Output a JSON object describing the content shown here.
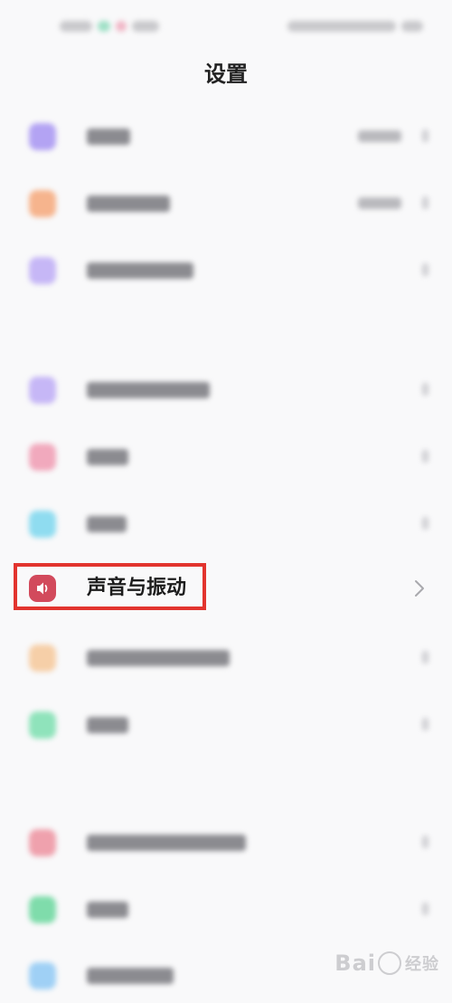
{
  "header": {
    "title": "设置"
  },
  "highlighted_item": {
    "label": "声音与振动",
    "icon": "speaker-icon"
  },
  "watermark": {
    "brand_left": "Bai",
    "brand_right": "经验"
  },
  "colors": {
    "highlight_border": "#e2342e",
    "sound_icon_bg": "#d24a5c",
    "icon_purple": "#b3a3f3",
    "icon_orange": "#f6b48d",
    "icon_violet": "#c6b7f6",
    "icon_pink": "#f1a9bd",
    "icon_cyan": "#8fdcf0",
    "icon_peach": "#f6cfa8",
    "icon_green": "#8fe3bb",
    "icon_rose": "#efa1ad",
    "icon_mint": "#7fdcab",
    "icon_sky": "#9fd0f5"
  }
}
